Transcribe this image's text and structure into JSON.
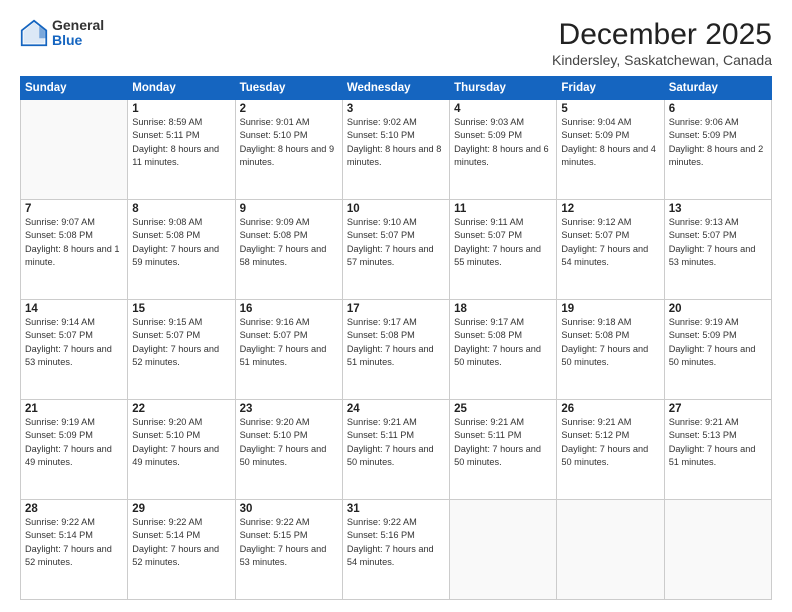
{
  "logo": {
    "general": "General",
    "blue": "Blue"
  },
  "header": {
    "month": "December 2025",
    "location": "Kindersley, Saskatchewan, Canada"
  },
  "weekdays": [
    "Sunday",
    "Monday",
    "Tuesday",
    "Wednesday",
    "Thursday",
    "Friday",
    "Saturday"
  ],
  "weeks": [
    [
      {
        "day": "",
        "sunrise": "",
        "sunset": "",
        "daylight": ""
      },
      {
        "day": "1",
        "sunrise": "Sunrise: 8:59 AM",
        "sunset": "Sunset: 5:11 PM",
        "daylight": "Daylight: 8 hours and 11 minutes."
      },
      {
        "day": "2",
        "sunrise": "Sunrise: 9:01 AM",
        "sunset": "Sunset: 5:10 PM",
        "daylight": "Daylight: 8 hours and 9 minutes."
      },
      {
        "day": "3",
        "sunrise": "Sunrise: 9:02 AM",
        "sunset": "Sunset: 5:10 PM",
        "daylight": "Daylight: 8 hours and 8 minutes."
      },
      {
        "day": "4",
        "sunrise": "Sunrise: 9:03 AM",
        "sunset": "Sunset: 5:09 PM",
        "daylight": "Daylight: 8 hours and 6 minutes."
      },
      {
        "day": "5",
        "sunrise": "Sunrise: 9:04 AM",
        "sunset": "Sunset: 5:09 PM",
        "daylight": "Daylight: 8 hours and 4 minutes."
      },
      {
        "day": "6",
        "sunrise": "Sunrise: 9:06 AM",
        "sunset": "Sunset: 5:09 PM",
        "daylight": "Daylight: 8 hours and 2 minutes."
      }
    ],
    [
      {
        "day": "7",
        "sunrise": "Sunrise: 9:07 AM",
        "sunset": "Sunset: 5:08 PM",
        "daylight": "Daylight: 8 hours and 1 minute."
      },
      {
        "day": "8",
        "sunrise": "Sunrise: 9:08 AM",
        "sunset": "Sunset: 5:08 PM",
        "daylight": "Daylight: 7 hours and 59 minutes."
      },
      {
        "day": "9",
        "sunrise": "Sunrise: 9:09 AM",
        "sunset": "Sunset: 5:08 PM",
        "daylight": "Daylight: 7 hours and 58 minutes."
      },
      {
        "day": "10",
        "sunrise": "Sunrise: 9:10 AM",
        "sunset": "Sunset: 5:07 PM",
        "daylight": "Daylight: 7 hours and 57 minutes."
      },
      {
        "day": "11",
        "sunrise": "Sunrise: 9:11 AM",
        "sunset": "Sunset: 5:07 PM",
        "daylight": "Daylight: 7 hours and 55 minutes."
      },
      {
        "day": "12",
        "sunrise": "Sunrise: 9:12 AM",
        "sunset": "Sunset: 5:07 PM",
        "daylight": "Daylight: 7 hours and 54 minutes."
      },
      {
        "day": "13",
        "sunrise": "Sunrise: 9:13 AM",
        "sunset": "Sunset: 5:07 PM",
        "daylight": "Daylight: 7 hours and 53 minutes."
      }
    ],
    [
      {
        "day": "14",
        "sunrise": "Sunrise: 9:14 AM",
        "sunset": "Sunset: 5:07 PM",
        "daylight": "Daylight: 7 hours and 53 minutes."
      },
      {
        "day": "15",
        "sunrise": "Sunrise: 9:15 AM",
        "sunset": "Sunset: 5:07 PM",
        "daylight": "Daylight: 7 hours and 52 minutes."
      },
      {
        "day": "16",
        "sunrise": "Sunrise: 9:16 AM",
        "sunset": "Sunset: 5:07 PM",
        "daylight": "Daylight: 7 hours and 51 minutes."
      },
      {
        "day": "17",
        "sunrise": "Sunrise: 9:17 AM",
        "sunset": "Sunset: 5:08 PM",
        "daylight": "Daylight: 7 hours and 51 minutes."
      },
      {
        "day": "18",
        "sunrise": "Sunrise: 9:17 AM",
        "sunset": "Sunset: 5:08 PM",
        "daylight": "Daylight: 7 hours and 50 minutes."
      },
      {
        "day": "19",
        "sunrise": "Sunrise: 9:18 AM",
        "sunset": "Sunset: 5:08 PM",
        "daylight": "Daylight: 7 hours and 50 minutes."
      },
      {
        "day": "20",
        "sunrise": "Sunrise: 9:19 AM",
        "sunset": "Sunset: 5:09 PM",
        "daylight": "Daylight: 7 hours and 50 minutes."
      }
    ],
    [
      {
        "day": "21",
        "sunrise": "Sunrise: 9:19 AM",
        "sunset": "Sunset: 5:09 PM",
        "daylight": "Daylight: 7 hours and 49 minutes."
      },
      {
        "day": "22",
        "sunrise": "Sunrise: 9:20 AM",
        "sunset": "Sunset: 5:10 PM",
        "daylight": "Daylight: 7 hours and 49 minutes."
      },
      {
        "day": "23",
        "sunrise": "Sunrise: 9:20 AM",
        "sunset": "Sunset: 5:10 PM",
        "daylight": "Daylight: 7 hours and 50 minutes."
      },
      {
        "day": "24",
        "sunrise": "Sunrise: 9:21 AM",
        "sunset": "Sunset: 5:11 PM",
        "daylight": "Daylight: 7 hours and 50 minutes."
      },
      {
        "day": "25",
        "sunrise": "Sunrise: 9:21 AM",
        "sunset": "Sunset: 5:11 PM",
        "daylight": "Daylight: 7 hours and 50 minutes."
      },
      {
        "day": "26",
        "sunrise": "Sunrise: 9:21 AM",
        "sunset": "Sunset: 5:12 PM",
        "daylight": "Daylight: 7 hours and 50 minutes."
      },
      {
        "day": "27",
        "sunrise": "Sunrise: 9:21 AM",
        "sunset": "Sunset: 5:13 PM",
        "daylight": "Daylight: 7 hours and 51 minutes."
      }
    ],
    [
      {
        "day": "28",
        "sunrise": "Sunrise: 9:22 AM",
        "sunset": "Sunset: 5:14 PM",
        "daylight": "Daylight: 7 hours and 52 minutes."
      },
      {
        "day": "29",
        "sunrise": "Sunrise: 9:22 AM",
        "sunset": "Sunset: 5:14 PM",
        "daylight": "Daylight: 7 hours and 52 minutes."
      },
      {
        "day": "30",
        "sunrise": "Sunrise: 9:22 AM",
        "sunset": "Sunset: 5:15 PM",
        "daylight": "Daylight: 7 hours and 53 minutes."
      },
      {
        "day": "31",
        "sunrise": "Sunrise: 9:22 AM",
        "sunset": "Sunset: 5:16 PM",
        "daylight": "Daylight: 7 hours and 54 minutes."
      },
      {
        "day": "",
        "sunrise": "",
        "sunset": "",
        "daylight": ""
      },
      {
        "day": "",
        "sunrise": "",
        "sunset": "",
        "daylight": ""
      },
      {
        "day": "",
        "sunrise": "",
        "sunset": "",
        "daylight": ""
      }
    ]
  ]
}
